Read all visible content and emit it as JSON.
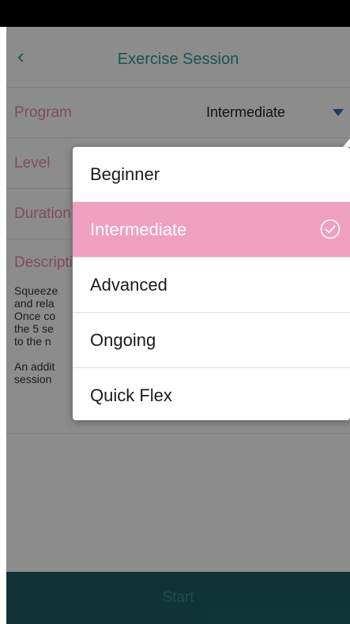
{
  "header": {
    "title": "Exercise Session",
    "back_glyph": "‹"
  },
  "program": {
    "label": "Program",
    "value": "Intermediate"
  },
  "level": {
    "label": "Level"
  },
  "duration": {
    "label": "Duration"
  },
  "description": {
    "label": "Description",
    "text": "Squeeze\nand rela\nOnce co\nthe 5 se\nto the n\n\nAn addit\nsession"
  },
  "start": {
    "label": "Start"
  },
  "dropdown": {
    "options": [
      {
        "label": "Beginner"
      },
      {
        "label": "Intermediate"
      },
      {
        "label": "Advanced"
      },
      {
        "label": "Ongoing"
      },
      {
        "label": "Quick Flex"
      }
    ],
    "selected": "Intermediate"
  },
  "colors": {
    "accent": "#2d9a9a",
    "label_pink": "#e98aa8",
    "selected_bg": "#f0a0bf",
    "start_bg": "#1f5e63"
  }
}
